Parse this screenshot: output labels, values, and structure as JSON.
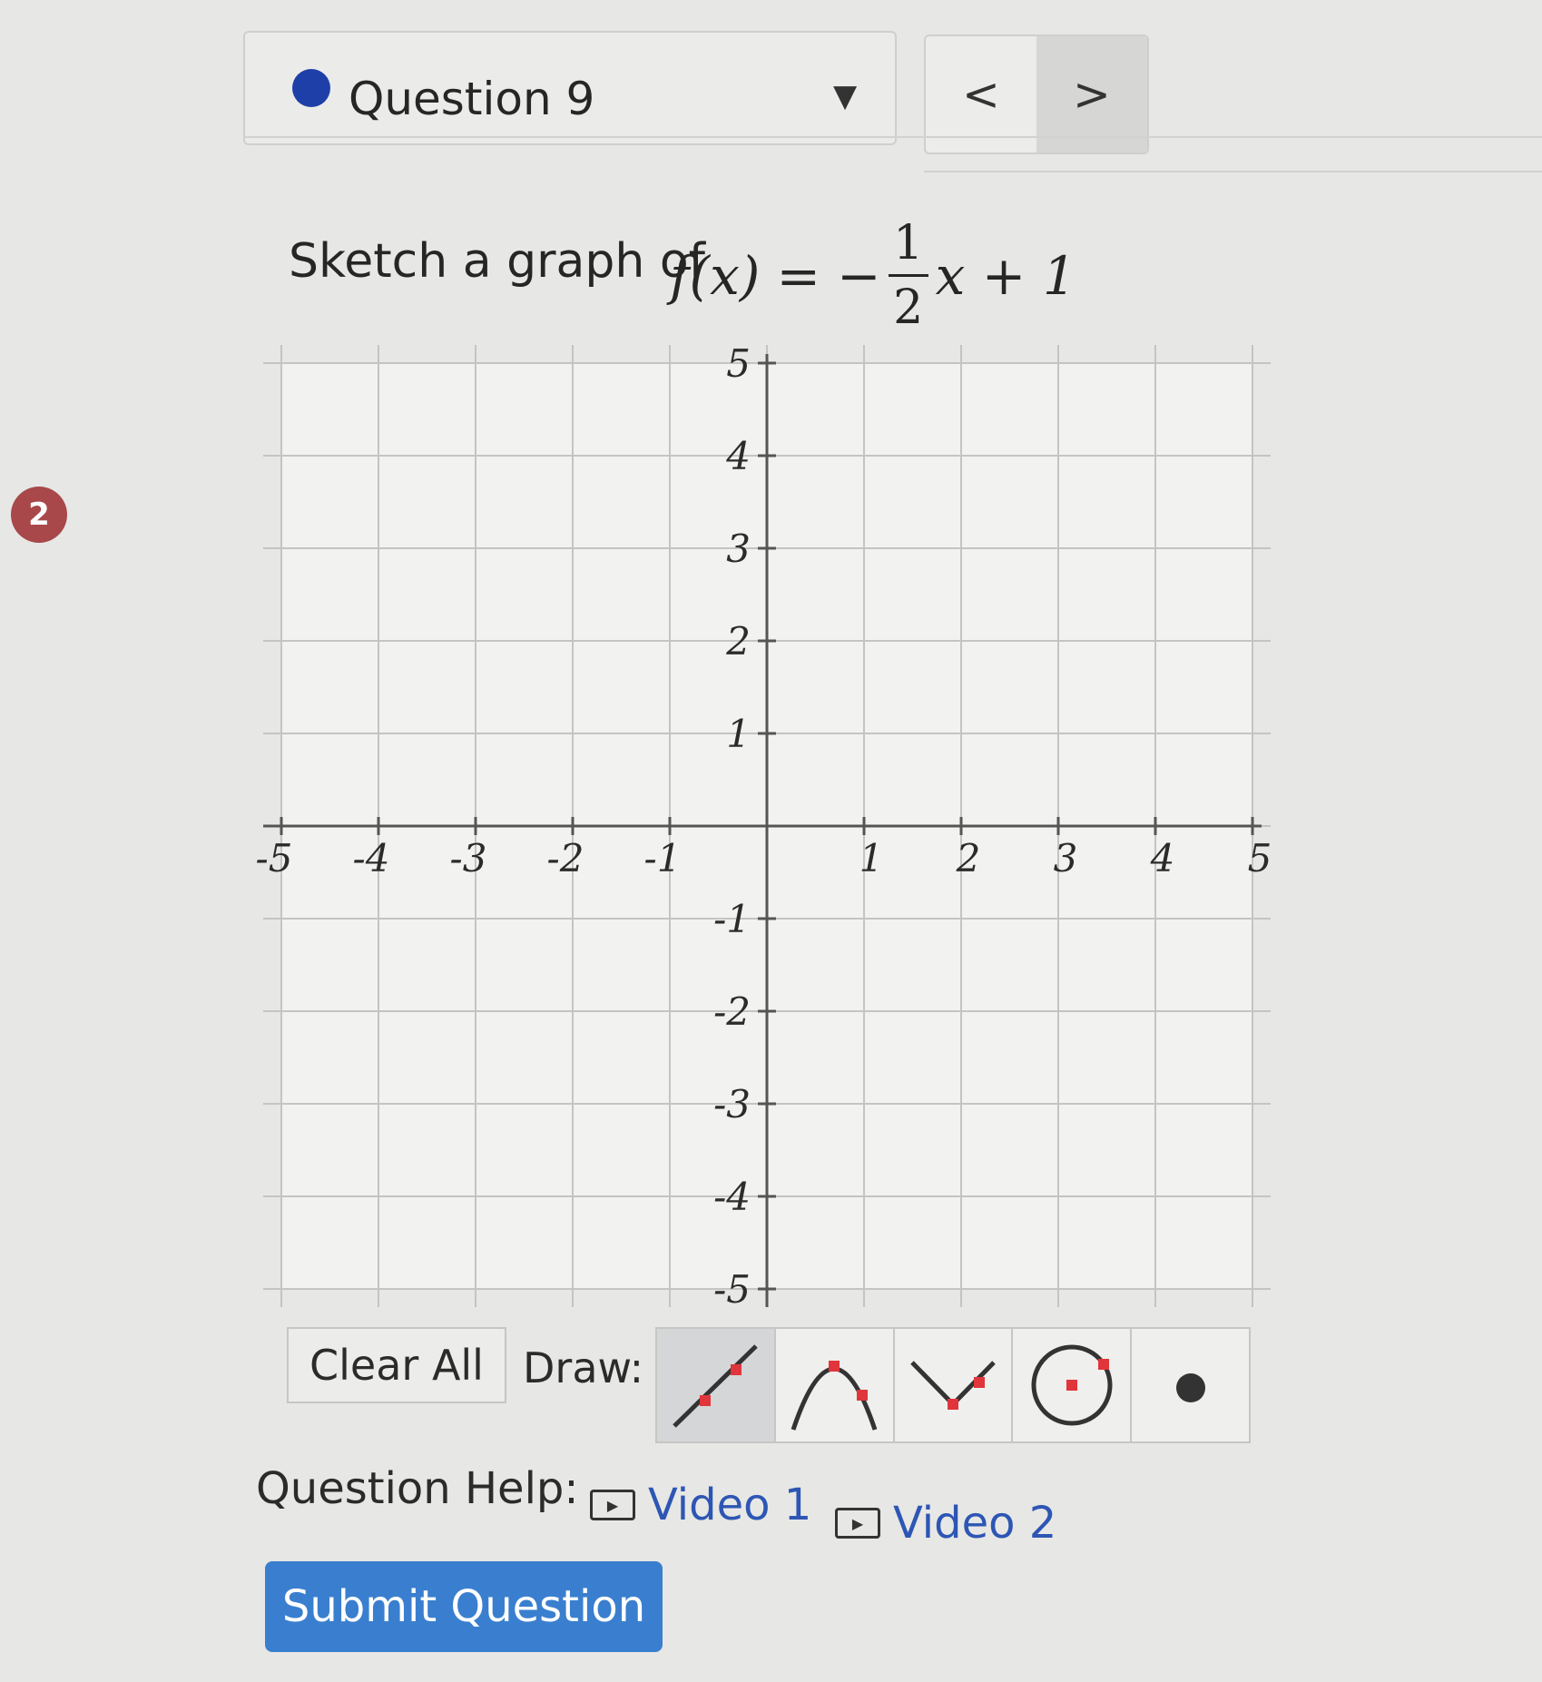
{
  "badge": {
    "number": "2"
  },
  "header": {
    "question_title": "Question 9",
    "dropdown_caret": "▼",
    "prev_label": "<",
    "next_label": ">"
  },
  "prompt": {
    "text": "Sketch a graph of",
    "function_name": "f(x)",
    "equals": "=",
    "sign": "−",
    "numerator": "1",
    "denominator": "2",
    "rest": "x + 1"
  },
  "graph": {
    "x_ticks": [
      "-5",
      "-4",
      "-3",
      "-2",
      "-1",
      "1",
      "2",
      "3",
      "4",
      "5"
    ],
    "y_ticks": [
      "5",
      "4",
      "3",
      "2",
      "1",
      "-1",
      "-2",
      "-3",
      "-4",
      "-5"
    ],
    "x_range": [
      -5,
      5
    ],
    "y_range": [
      -5,
      5
    ],
    "grid": true
  },
  "toolbar": {
    "clear_label": "Clear All",
    "draw_label": "Draw:",
    "tools": [
      {
        "icon": "line-icon",
        "active": true
      },
      {
        "icon": "parabola-down-icon",
        "active": false
      },
      {
        "icon": "absolute-value-icon",
        "active": false
      },
      {
        "icon": "circle-icon",
        "active": false
      },
      {
        "icon": "point-icon",
        "active": false
      }
    ],
    "accent_color": "#e0353a"
  },
  "help": {
    "label": "Question Help:",
    "video1": "Video 1",
    "video2": "Video 2"
  },
  "submit": {
    "label": "Submit Question",
    "color": "#3a7fcf"
  }
}
